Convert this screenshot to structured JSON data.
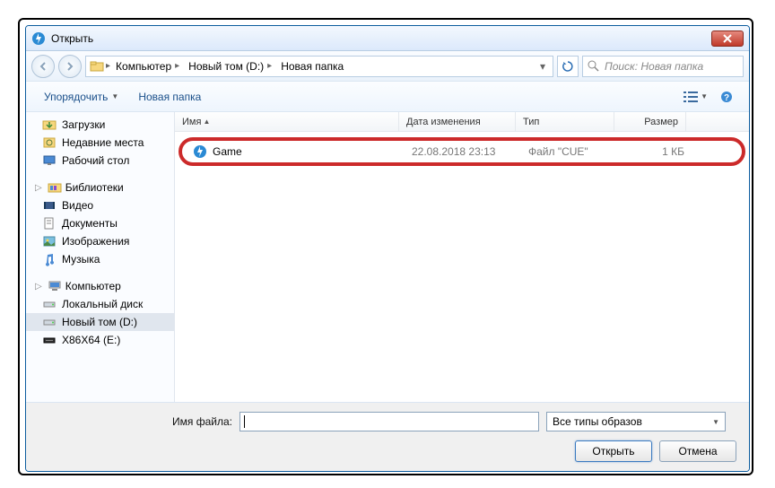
{
  "window": {
    "title": "Открыть"
  },
  "breadcrumb": {
    "items": [
      "Компьютер",
      "Новый том (D:)",
      "Новая папка"
    ]
  },
  "search": {
    "placeholder": "Поиск: Новая папка"
  },
  "toolbar": {
    "organize": "Упорядочить",
    "newfolder": "Новая папка"
  },
  "columns": {
    "name": "Имя",
    "date": "Дата изменения",
    "type": "Тип",
    "size": "Размер"
  },
  "files": [
    {
      "name": "Game",
      "date": "22.08.2018 23:13",
      "type": "Файл \"CUE\"",
      "size": "1 КБ"
    }
  ],
  "sidebar": {
    "downloads": "Загрузки",
    "recent": "Недавние места",
    "desktop": "Рабочий стол",
    "libraries": "Библиотеки",
    "video": "Видео",
    "documents": "Документы",
    "pictures": "Изображения",
    "music": "Музыка",
    "computer": "Компьютер",
    "localdisk": "Локальный диск",
    "newvol": "Новый том (D:)",
    "x86x64": "X86X64 (E:)"
  },
  "footer": {
    "filename_label": "Имя файла:",
    "filter": "Все типы образов",
    "open": "Открыть",
    "cancel": "Отмена"
  }
}
